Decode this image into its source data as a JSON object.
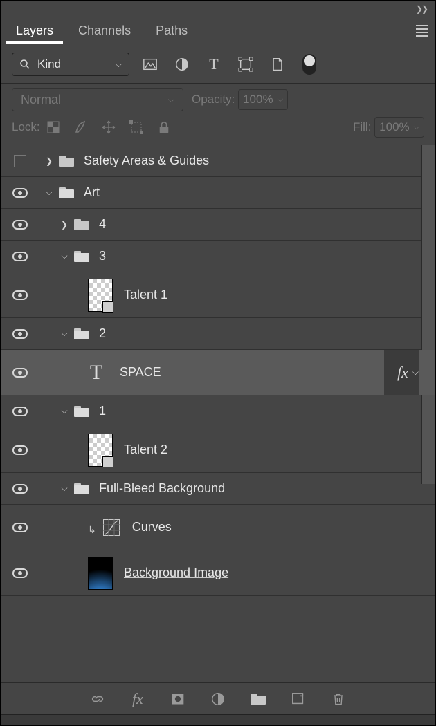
{
  "tabs": {
    "layers": "Layers",
    "channels": "Channels",
    "paths": "Paths"
  },
  "filter": {
    "kind": "Kind"
  },
  "blend": {
    "mode": "Normal",
    "opacity_label": "Opacity:",
    "opacity_value": "100%"
  },
  "lock": {
    "label": "Lock:",
    "fill_label": "Fill:",
    "fill_value": "100%"
  },
  "layers": {
    "safety": "Safety Areas & Guides",
    "art": "Art",
    "g4": "4",
    "g3": "3",
    "talent1": "Talent 1",
    "g2": "2",
    "space": "SPACE",
    "fx": "fx",
    "g1": "1",
    "talent2": "Talent 2",
    "fullbleed": "Full-Bleed Background",
    "curves": "Curves",
    "bgimage": "Background Image"
  }
}
